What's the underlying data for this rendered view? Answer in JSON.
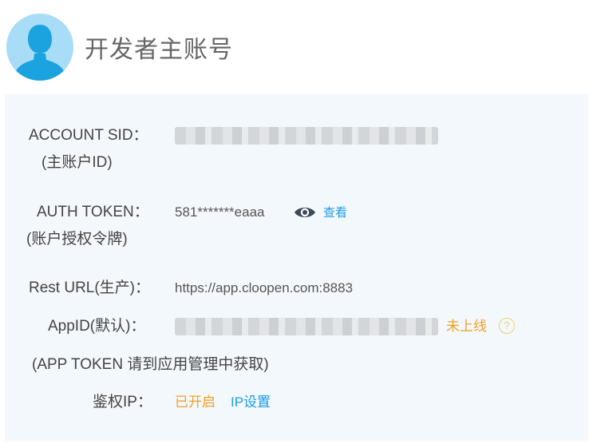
{
  "header": {
    "title": "开发者主账号"
  },
  "account_sid": {
    "label": "ACCOUNT SID：",
    "sublabel": "(主账户ID)"
  },
  "auth_token": {
    "label": "AUTH TOKEN：",
    "sublabel": "(账户授权令牌)",
    "value": "581*******eaaa",
    "view_label": "查看"
  },
  "rest_url": {
    "label": "Rest URL(生产)：",
    "value": "https://app.cloopen.com:8883"
  },
  "app_id": {
    "label": "AppID(默认)：",
    "status": "未上线",
    "help_glyph": "?"
  },
  "app_token_note": "(APP TOKEN 请到应用管理中获取)",
  "auth_ip": {
    "label": "鉴权IP：",
    "status": "已开启",
    "settings_link": "IP设置"
  },
  "colors": {
    "panel_bg": "#f3f8fd",
    "link_blue": "#1a9ce0",
    "status_orange": "#f0a020",
    "avatar_bg": "#a9dcf6",
    "avatar_fg": "#1aa3df"
  },
  "icons": {
    "avatar": "user-silhouette-icon",
    "view": "eye-icon",
    "help": "question-circle-icon"
  }
}
